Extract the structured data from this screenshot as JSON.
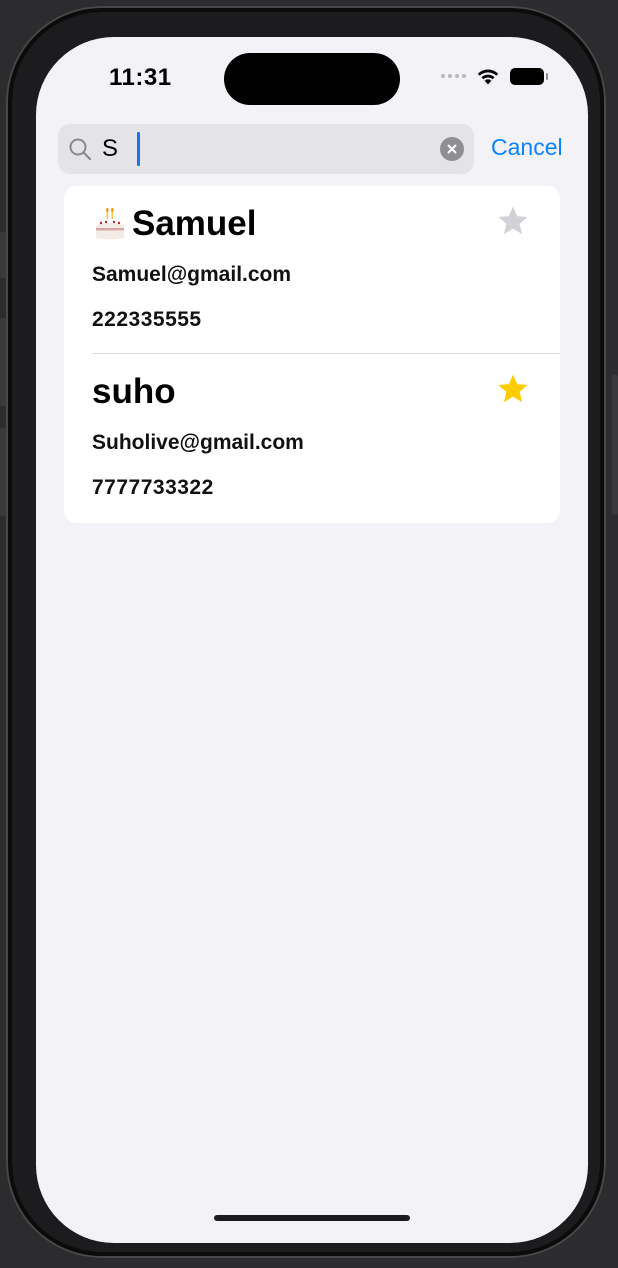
{
  "status_bar": {
    "time": "11:31"
  },
  "search": {
    "query": "S",
    "cancel_label": "Cancel"
  },
  "results": [
    {
      "name": "Samuel",
      "email": "Samuel@gmail.com",
      "phone": "222335555",
      "birthday_icon": "birthday-cake-icon",
      "favorite": false
    },
    {
      "name": "suho",
      "email": "Suholive@gmail.com",
      "phone": "7777733322",
      "favorite": true
    }
  ],
  "colors": {
    "accent": "#0a84ff",
    "star_active": "#ffcc00",
    "star_inactive": "#d1d1d6",
    "background": "#f2f2f7",
    "card": "#ffffff"
  }
}
